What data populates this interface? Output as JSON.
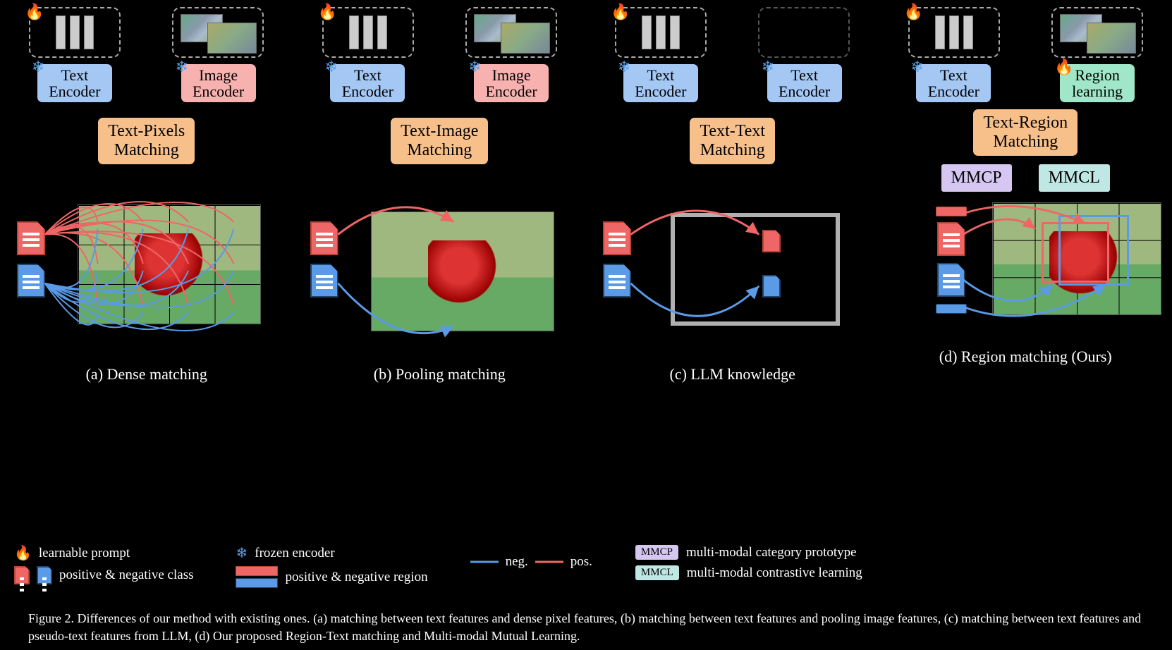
{
  "columns": {
    "a": {
      "text_encoder": "Text\nEncoder",
      "image_encoder": "Image\nEncoder",
      "match": "Text-Pixels\nMatching",
      "caption": "(a) Dense matching"
    },
    "b": {
      "text_encoder": "Text\nEncoder",
      "image_encoder": "Image\nEncoder",
      "match": "Text-Image\nMatching",
      "caption": "(b) Pooling matching"
    },
    "c": {
      "text_encoder": "Text\nEncoder",
      "text_encoder2": "Text\nEncoder",
      "match": "Text-Text\nMatching",
      "caption": "(c) LLM knowledge"
    },
    "d": {
      "text_encoder": "Text\nEncoder",
      "region_learning": "Region\nlearning",
      "match": "Text-Region\nMatching",
      "mmcp": "MMCP",
      "mmcl": "MMCL",
      "caption": "(d) Region matching (Ours)"
    }
  },
  "legend": {
    "fire": "learnable prompt",
    "snow": "frozen encoder",
    "doc": "positive & negative class",
    "bars": "positive & negative region",
    "line_neg": "neg.",
    "line_pos": "pos.",
    "mmcp": "MMCP",
    "mmcl": "MMCL",
    "mmcp_desc": "multi-modal category prototype",
    "mmcl_desc": "multi-modal contrastive learning"
  },
  "figure_caption": "Figure 2. Differences of our method with existing ones. (a) matching between text features and dense pixel features, (b) matching between text features and pooling image features, (c) matching between text features and pseudo-text features from LLM, (d) Our proposed Region-Text matching and Multi-modal Mutual Learning."
}
